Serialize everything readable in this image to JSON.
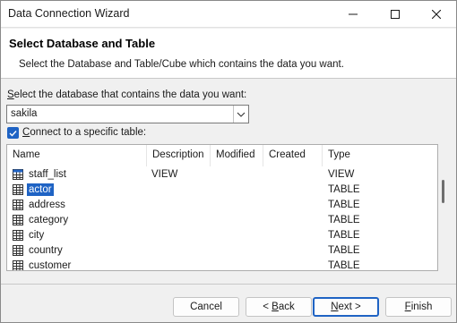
{
  "window": {
    "title": "Data Connection Wizard"
  },
  "header": {
    "title": "Select Database and Table",
    "subtitle": "Select the Database and Table/Cube which contains the data you want."
  },
  "database": {
    "label_prefix": "S",
    "label_rest": "elect the database that contains the data you want:",
    "selected": "sakila"
  },
  "connect_checkbox": {
    "checked": true,
    "label_prefix": "C",
    "label_rest": "onnect to a specific table:"
  },
  "table_list": {
    "columns": [
      "Name",
      "Description",
      "Modified",
      "Created",
      "Type"
    ],
    "rows": [
      {
        "name": "staff_list",
        "description": "VIEW",
        "modified": "",
        "created": "",
        "type": "VIEW",
        "icon": "view-icon",
        "selected": false
      },
      {
        "name": "actor",
        "description": "",
        "modified": "",
        "created": "",
        "type": "TABLE",
        "icon": "table-icon",
        "selected": true
      },
      {
        "name": "address",
        "description": "",
        "modified": "",
        "created": "",
        "type": "TABLE",
        "icon": "table-icon",
        "selected": false
      },
      {
        "name": "category",
        "description": "",
        "modified": "",
        "created": "",
        "type": "TABLE",
        "icon": "table-icon",
        "selected": false
      },
      {
        "name": "city",
        "description": "",
        "modified": "",
        "created": "",
        "type": "TABLE",
        "icon": "table-icon",
        "selected": false
      },
      {
        "name": "country",
        "description": "",
        "modified": "",
        "created": "",
        "type": "TABLE",
        "icon": "table-icon",
        "selected": false
      },
      {
        "name": "customer",
        "description": "",
        "modified": "",
        "created": "",
        "type": "TABLE",
        "icon": "table-icon",
        "selected": false
      }
    ]
  },
  "buttons": {
    "cancel": "Cancel",
    "back_prefix": "< ",
    "back_key": "B",
    "back_rest": "ack",
    "next_key": "N",
    "next_rest": "ext >",
    "finish_key": "F",
    "finish_rest": "inish"
  },
  "colors": {
    "accent": "#1f63c4",
    "selection_text": "#ffffff"
  }
}
